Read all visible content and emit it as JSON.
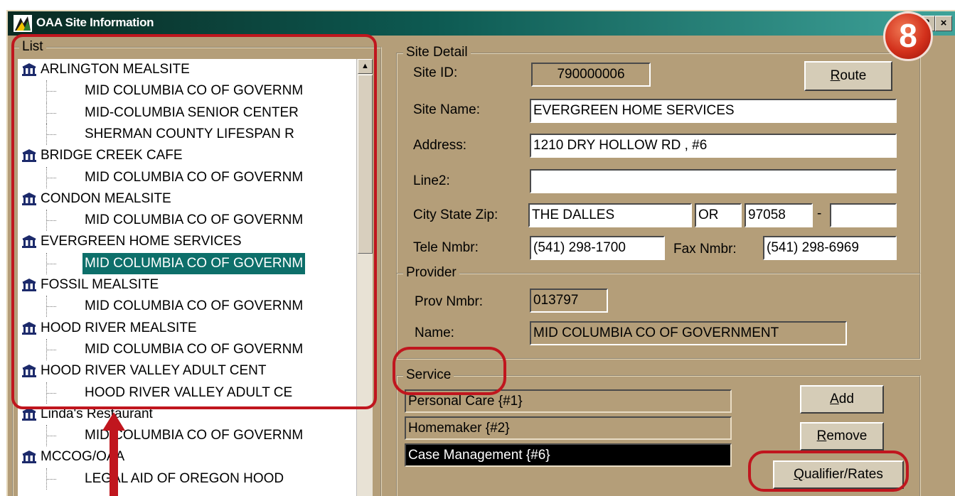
{
  "window": {
    "title": "OAA Site Information",
    "help_glyph": "?",
    "close_glyph": "×"
  },
  "annotation": {
    "step_number": "8"
  },
  "list_group": {
    "legend": "List",
    "items": [
      {
        "label": "ARLINGTON MEALSITE",
        "level": "site"
      },
      {
        "label": "MID COLUMBIA CO OF GOVERNM",
        "level": "provider"
      },
      {
        "label": "MID-COLUMBIA SENIOR CENTER",
        "level": "provider"
      },
      {
        "label": "SHERMAN COUNTY LIFESPAN R",
        "level": "provider"
      },
      {
        "label": "BRIDGE CREEK CAFE",
        "level": "site"
      },
      {
        "label": "MID COLUMBIA CO OF GOVERNM",
        "level": "provider"
      },
      {
        "label": "CONDON MEALSITE",
        "level": "site"
      },
      {
        "label": "MID COLUMBIA CO OF GOVERNM",
        "level": "provider"
      },
      {
        "label": "EVERGREEN HOME SERVICES",
        "level": "site"
      },
      {
        "label": "MID COLUMBIA CO OF GOVERNM",
        "level": "provider",
        "selected": true
      },
      {
        "label": "FOSSIL MEALSITE",
        "level": "site"
      },
      {
        "label": "MID COLUMBIA CO OF GOVERNM",
        "level": "provider"
      },
      {
        "label": "HOOD RIVER MEALSITE",
        "level": "site"
      },
      {
        "label": "MID COLUMBIA CO OF GOVERNM",
        "level": "provider"
      },
      {
        "label": "HOOD RIVER VALLEY ADULT CENT",
        "level": "site"
      },
      {
        "label": "HOOD RIVER VALLEY ADULT CE",
        "level": "provider"
      },
      {
        "label": "Linda's Restaurant",
        "level": "site"
      },
      {
        "label": "MID COLUMBIA CO OF GOVERNM",
        "level": "provider"
      },
      {
        "label": "MCCOG/OAA",
        "level": "site"
      },
      {
        "label": "LEGAL AID OF OREGON HOOD",
        "level": "provider"
      }
    ]
  },
  "site_detail": {
    "legend": "Site Detail",
    "site_id_label": "Site ID:",
    "site_id_value": "790000006",
    "route_button": "Route",
    "site_name_label": "Site Name:",
    "site_name_value": "EVERGREEN HOME SERVICES",
    "address_label": "Address:",
    "address_value": "1210 DRY HOLLOW RD , #6",
    "line2_label": "Line2:",
    "line2_value": "",
    "city_state_zip_label": "City State Zip:",
    "city_value": "THE DALLES",
    "state_value": "OR",
    "zip_value": "97058",
    "zip_dash": "-",
    "zip_ext_value": "",
    "tele_label": "Tele Nmbr:",
    "tele_value": "(541) 298-1700",
    "fax_label": "Fax Nmbr:",
    "fax_value": "(541) 298-6969"
  },
  "provider": {
    "legend": "Provider",
    "prov_nmbr_label": "Prov Nmbr:",
    "prov_nmbr_value": "013797",
    "name_label": "Name:",
    "name_value": "MID COLUMBIA CO OF GOVERNMENT"
  },
  "service": {
    "legend": "Service",
    "items": [
      {
        "label": "Personal Care {#1}"
      },
      {
        "label": "Homemaker {#2}"
      },
      {
        "label": "Case Management {#6}",
        "selected": true
      }
    ],
    "add_button": "Add",
    "remove_button": "Remove",
    "qualifier_button": "Qualifier/Rates"
  },
  "colors": {
    "window_bg": "#b49e79",
    "selection": "#0d6f6a",
    "callout": "#c0161e"
  }
}
